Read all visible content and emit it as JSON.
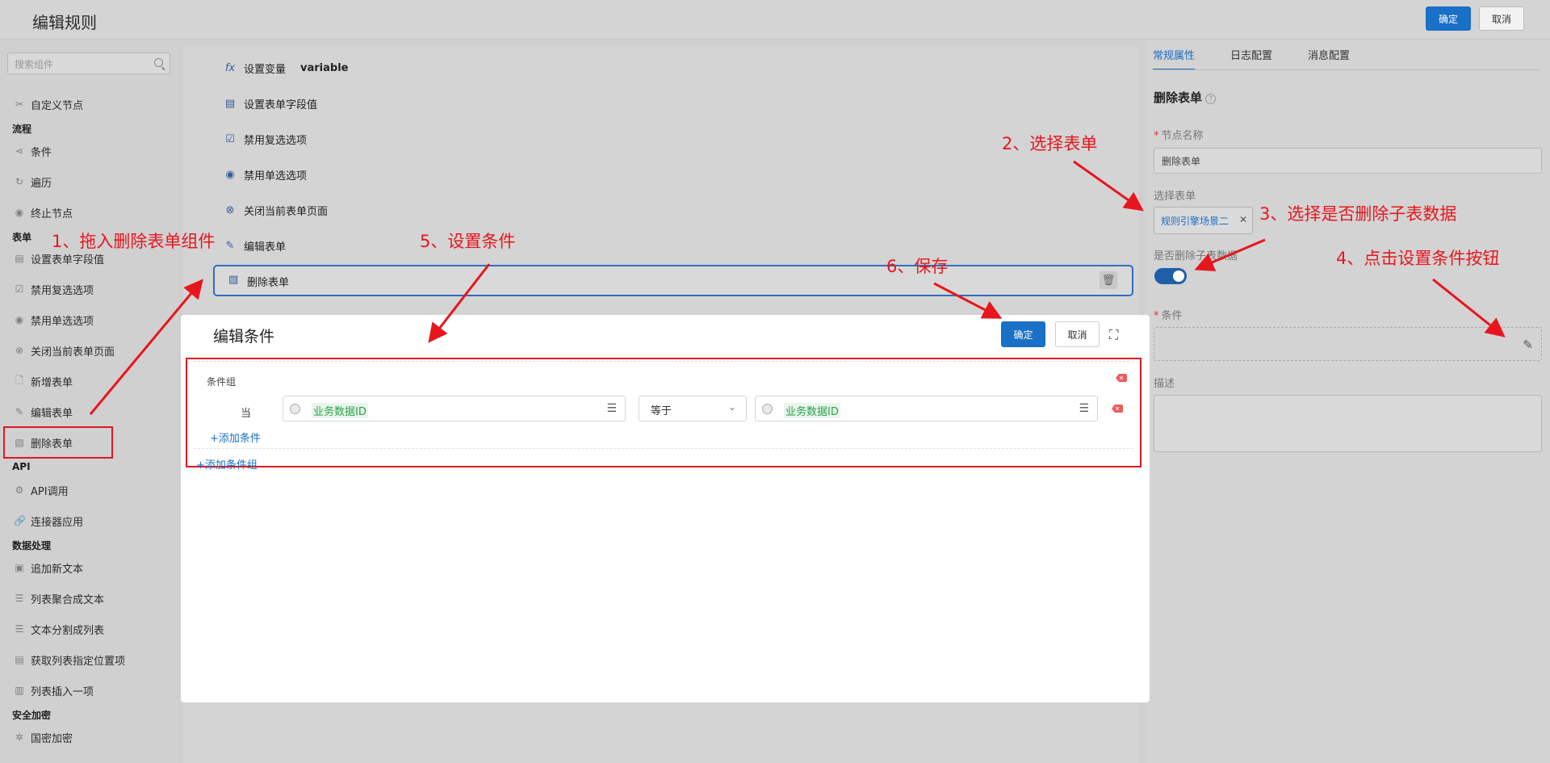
{
  "header": {
    "title": "编辑规则",
    "confirm_label": "确定",
    "cancel_label": "取消"
  },
  "sidebar": {
    "search_placeholder": "搜索组件",
    "custom_node": "自定义节点",
    "categories": {
      "flow": "流程",
      "form": "表单",
      "api": "API",
      "data": "数据处理",
      "security": "安全加密"
    },
    "flow_items": [
      "条件",
      "遍历",
      "终止节点"
    ],
    "form_items": [
      "设置表单字段值",
      "禁用复选选项",
      "禁用单选选项",
      "关闭当前表单页面",
      "新增表单",
      "编辑表单",
      "删除表单"
    ],
    "api_items": [
      "API调用",
      "连接器应用"
    ],
    "data_items": [
      "追加新文本",
      "列表聚合成文本",
      "文本分割成列表",
      "获取列表指定位置项",
      "列表插入一项"
    ],
    "security_items": [
      "国密加密"
    ]
  },
  "canvas": {
    "items": [
      {
        "label": "设置变量",
        "extra": "variable"
      },
      {
        "label": "设置表单字段值"
      },
      {
        "label": "禁用复选选项"
      },
      {
        "label": "禁用单选选项"
      },
      {
        "label": "关闭当前表单页面"
      },
      {
        "label": "编辑表单"
      }
    ],
    "selected_item": "删除表单"
  },
  "right_panel": {
    "tabs": [
      "常规属性",
      "日志配置",
      "消息配置"
    ],
    "title": "删除表单",
    "node_name_label": "节点名称",
    "node_name_value": "删除表单",
    "select_form_label": "选择表单",
    "select_form_tag": "规则引擎场景二",
    "delete_sub_label": "是否删除子表数据",
    "delete_sub_value": true,
    "condition_label": "条件",
    "description_label": "描述"
  },
  "modal": {
    "title": "编辑条件",
    "confirm_label": "确定",
    "cancel_label": "取消",
    "group_label": "条件组",
    "when_label": "当",
    "left_field": "业务数据ID",
    "operator": "等于",
    "right_field": "业务数据ID",
    "add_condition": "+添加条件",
    "add_group": "+添加条件组"
  },
  "annotations": {
    "step1": "1、拖入删除表单组件",
    "step2": "2、选择表单",
    "step3": "3、选择是否删除子表数据",
    "step4": "4、点击设置条件按钮",
    "step5": "5、设置条件",
    "step6": "6、保存"
  },
  "colors": {
    "primary": "#1a6fc7",
    "annotation": "#e7161e",
    "field_value": "#2ba14c"
  }
}
